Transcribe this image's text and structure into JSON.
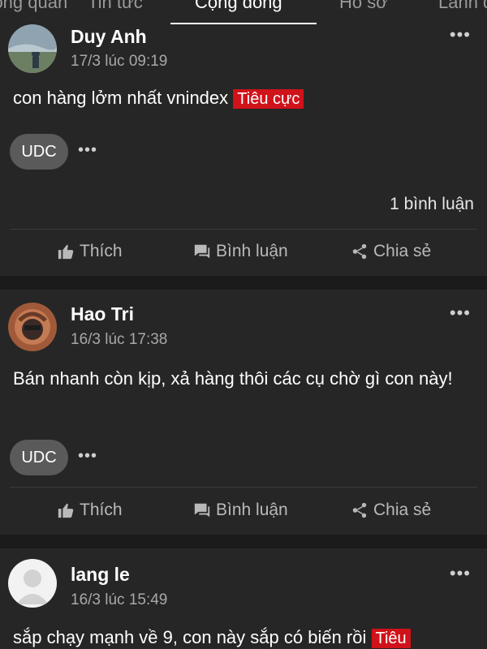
{
  "tabs": [
    {
      "label": "Tổng quan"
    },
    {
      "label": "Tin tức"
    },
    {
      "label": "Cộng đồng"
    },
    {
      "label": "Hồ sơ"
    },
    {
      "label": "Lãnh đạo"
    }
  ],
  "posts": [
    {
      "author": "Duy Anh",
      "time": "17/3 lúc 09:19",
      "text": "con hàng lởm nhất vnindex",
      "sentiment": "Tiêu cực",
      "ticker": "UDC",
      "comments": "1 bình luận"
    },
    {
      "author": "Hao Tri",
      "time": "16/3 lúc 17:38",
      "text": "Bán nhanh còn kịp, xả hàng thôi các cụ chờ gì con này!",
      "ticker": "UDC"
    },
    {
      "author": "lang le",
      "time": "16/3 lúc 15:49",
      "text": "sắp chạy mạnh về 9, con này sắp có biến rồi",
      "sentiment": "Tiêu"
    }
  ],
  "actions": {
    "like": "Thích",
    "comment": "Bình luận",
    "share": "Chia sẻ"
  },
  "colors": {
    "background": "#1b1b1b",
    "card": "#262626",
    "negative_tag": "#d0121a",
    "ticker_chip": "#5a5a5a"
  }
}
